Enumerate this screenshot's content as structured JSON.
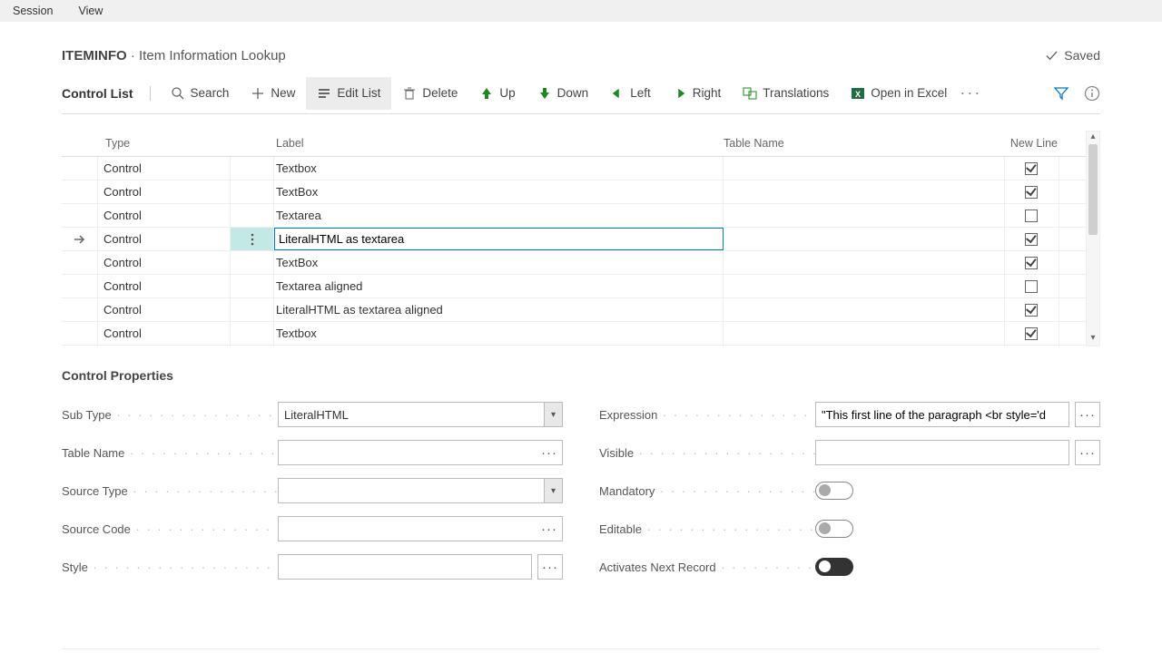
{
  "menu": {
    "session": "Session",
    "view": "View"
  },
  "header": {
    "code": "ITEMINFO",
    "sep": " · ",
    "title": "Item Information Lookup",
    "saved": "Saved"
  },
  "toolbar": {
    "group": "Control List",
    "search": "Search",
    "new": "New",
    "edit": "Edit List",
    "delete": "Delete",
    "up": "Up",
    "down": "Down",
    "left": "Left",
    "right": "Right",
    "translations": "Translations",
    "excel": "Open in Excel"
  },
  "grid": {
    "headers": {
      "type": "Type",
      "label": "Label",
      "table": "Table Name",
      "newline": "New Line"
    },
    "rows": [
      {
        "type": "Control",
        "label": "Textbox",
        "table": "",
        "newline": true,
        "selected": false
      },
      {
        "type": "Control",
        "label": "TextBox",
        "table": "",
        "newline": true,
        "selected": false
      },
      {
        "type": "Control",
        "label": "Textarea",
        "table": "",
        "newline": false,
        "selected": false
      },
      {
        "type": "Control",
        "label": "LiteralHTML as textarea",
        "table": "",
        "newline": true,
        "selected": true
      },
      {
        "type": "Control",
        "label": "TextBox",
        "table": "",
        "newline": true,
        "selected": false
      },
      {
        "type": "Control",
        "label": "Textarea aligned",
        "table": "",
        "newline": false,
        "selected": false
      },
      {
        "type": "Control",
        "label": "LiteralHTML as textarea aligned",
        "table": "",
        "newline": true,
        "selected": false
      },
      {
        "type": "Control",
        "label": "Textbox",
        "table": "",
        "newline": true,
        "selected": false
      }
    ]
  },
  "props": {
    "title": "Control Properties",
    "subtype_label": "Sub Type",
    "subtype_value": "LiteralHTML",
    "tablename_label": "Table Name",
    "tablename_value": "",
    "sourcetype_label": "Source Type",
    "sourcetype_value": "",
    "sourcecode_label": "Source Code",
    "sourcecode_value": "",
    "style_label": "Style",
    "style_value": "",
    "expression_label": "Expression",
    "expression_value": "\"This first line of the paragraph <br style='d",
    "visible_label": "Visible",
    "visible_value": "",
    "mandatory_label": "Mandatory",
    "mandatory_value": false,
    "editable_label": "Editable",
    "editable_value": false,
    "activates_label": "Activates Next Record",
    "activates_value": true
  }
}
